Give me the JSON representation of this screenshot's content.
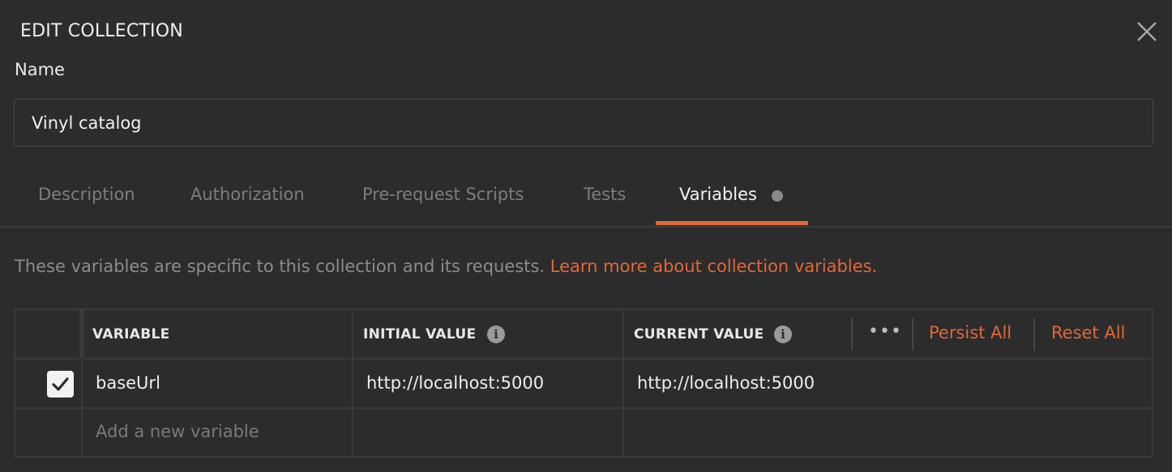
{
  "dialog": {
    "title": "EDIT COLLECTION",
    "name_label": "Name",
    "name_value": "Vinyl catalog"
  },
  "tabs": [
    {
      "label": "Description",
      "active": false
    },
    {
      "label": "Authorization",
      "active": false
    },
    {
      "label": "Pre-request Scripts",
      "active": false
    },
    {
      "label": "Tests",
      "active": false
    },
    {
      "label": "Variables",
      "active": true
    }
  ],
  "info": {
    "text": "These variables are specific to this collection and its requests.",
    "link": "Learn more about collection variables."
  },
  "table": {
    "headers": {
      "variable": "VARIABLE",
      "initial_value": "INITIAL VALUE",
      "current_value": "CURRENT VALUE"
    },
    "actions": {
      "more": "•••",
      "persist_all": "Persist All",
      "reset_all": "Reset All"
    },
    "rows": [
      {
        "enabled": true,
        "variable": "baseUrl",
        "initial_value": "http://localhost:5000",
        "current_value": "http://localhost:5000"
      }
    ],
    "new_row_placeholder": "Add a new variable"
  },
  "colors": {
    "background": "#2c2c2c",
    "accent": "#e0683a",
    "border": "#3a3a3a",
    "muted_text": "#8c8c8c"
  },
  "icons": {
    "close": "close-icon",
    "info": "info-icon",
    "check": "checkmark-icon",
    "more": "more-horizontal-icon"
  }
}
